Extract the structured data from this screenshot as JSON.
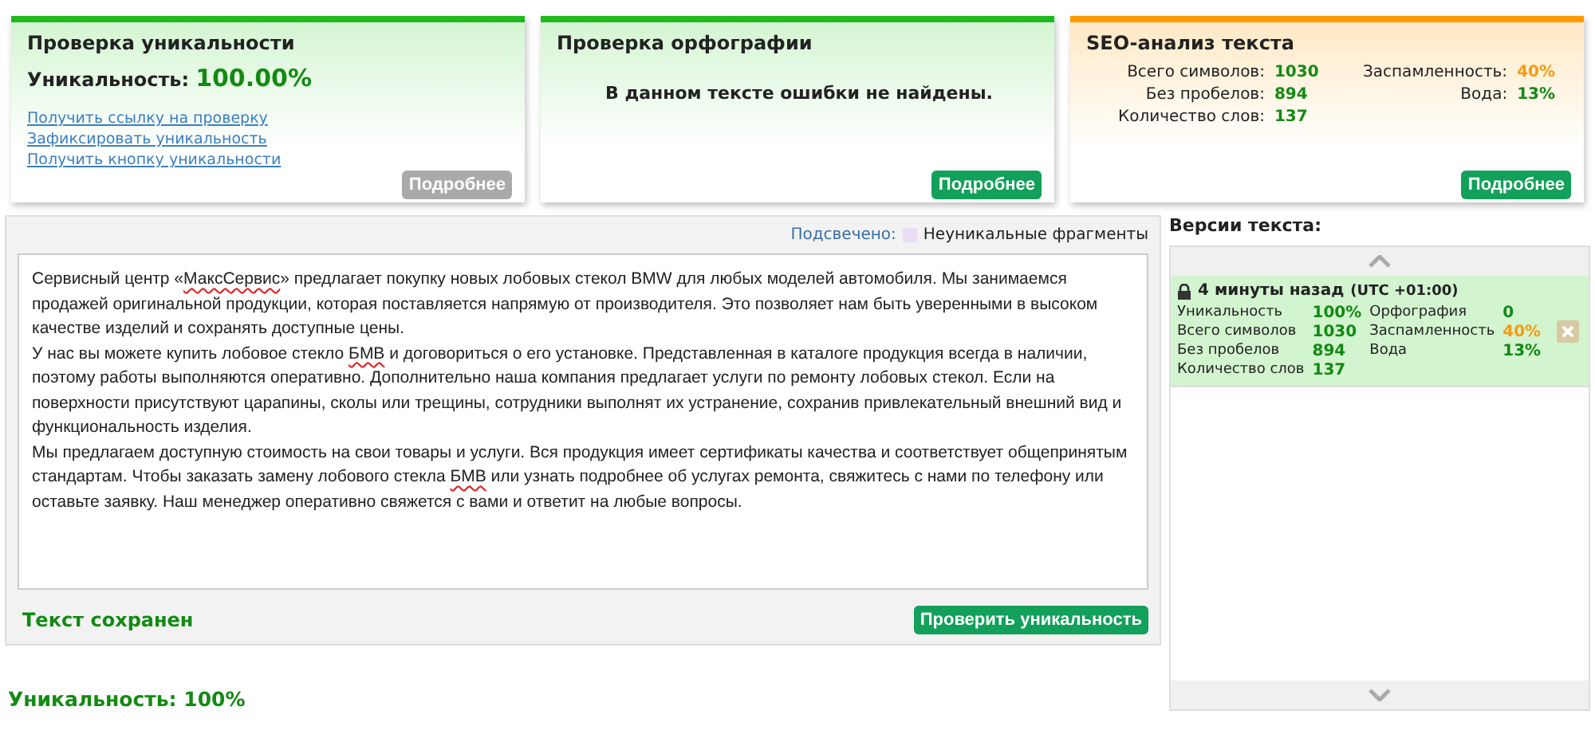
{
  "uniqueness_card": {
    "title": "Проверка уникальности",
    "label": "Уникальность:",
    "value": "100.00%",
    "links": [
      "Получить ссылку на проверку",
      "Зафиксировать уникальность",
      "Получить кнопку уникальности"
    ],
    "button": {
      "label": "Подробнее",
      "disabled": true
    }
  },
  "spelling_card": {
    "title": "Проверка орфографии",
    "message": "В данном тексте ошибки не найдены.",
    "button": {
      "label": "Подробнее",
      "disabled": false
    }
  },
  "seo_card": {
    "title": "SEO-анализ текста",
    "left_stats": [
      {
        "label": "Всего символов:",
        "value": "1030",
        "color": "#138a13"
      },
      {
        "label": "Без пробелов:",
        "value": "894",
        "color": "#138a13"
      },
      {
        "label": "Количество слов:",
        "value": "137",
        "color": "#138a13"
      }
    ],
    "right_stats": [
      {
        "label": "Заспамленность:",
        "value": "40%",
        "color": "#f59a0f"
      },
      {
        "label": "Вода:",
        "value": "13%",
        "color": "#138a13"
      }
    ],
    "button": {
      "label": "Подробнее",
      "disabled": false
    }
  },
  "editor": {
    "legend": {
      "label": "Подсвечено:",
      "text": "Неуникальные фрагменты",
      "color": "#eadcf5"
    },
    "paragraphs": [
      [
        {
          "text": "Сервисный центр «",
          "misspelled": false
        },
        {
          "text": "МаксСервис",
          "misspelled": true
        },
        {
          "text": "» предлагает покупку новых лобовых стекол BMW для любых моделей автомобиля. Мы занимаемся продажей оригинальной продукции, которая поставляется напрямую от производителя. Это позволяет нам быть уверенными в высоком качестве изделий и сохранять доступные цены.",
          "misspelled": false
        }
      ],
      [
        {
          "text": "У нас вы можете купить лобовое стекло ",
          "misspelled": false
        },
        {
          "text": "БМВ",
          "misspelled": true
        },
        {
          "text": " и договориться о его установке. Представленная в каталоге продукция всегда в наличии, поэтому работы выполняются оперативно. Дополнительно наша компания предлагает услуги по ремонту лобовых стекол. Если на поверхности присутствуют царапины, сколы или трещины, сотрудники выполнят их устранение, сохранив привлекательный внешний вид и функциональность изделия.",
          "misspelled": false
        }
      ],
      [
        {
          "text": "Мы предлагаем доступную стоимость на свои товары и услуги. Вся продукция имеет сертификаты качества и соответствует общепринятым стандартам. Чтобы заказать замену лобового стекла ",
          "misspelled": false
        },
        {
          "text": "БМВ",
          "misspelled": true
        },
        {
          "text": " или узнать подробнее об услугах ремонта, свяжитесь с нами по телефону или оставьте заявку. Наш менеджер оперативно свяжется с вами и ответит на любые вопросы.",
          "misspelled": false
        }
      ]
    ],
    "status": "Текст сохранен",
    "button": "Проверить уникальность"
  },
  "versions": {
    "title": "Версии текста:",
    "items": [
      {
        "time": "4 минуты назад",
        "timezone": "(UTC +01:00)",
        "selected": true,
        "stats": [
          {
            "label": "Уникальность",
            "value": "100%",
            "color": "#138a13"
          },
          {
            "label": "Орфография",
            "value": "0",
            "color": "#138a13"
          },
          {
            "label": "Всего символов",
            "value": "1030",
            "color": "#138a13"
          },
          {
            "label": "Заспамленность",
            "value": "40%",
            "color": "#f59a0f"
          },
          {
            "label": "Без пробелов",
            "value": "894",
            "color": "#138a13"
          },
          {
            "label": "Вода",
            "value": "13%",
            "color": "#138a13"
          },
          {
            "label": "Количество слов",
            "value": "137",
            "color": "#138a13"
          }
        ]
      }
    ]
  },
  "result": "Уникальность: 100%"
}
